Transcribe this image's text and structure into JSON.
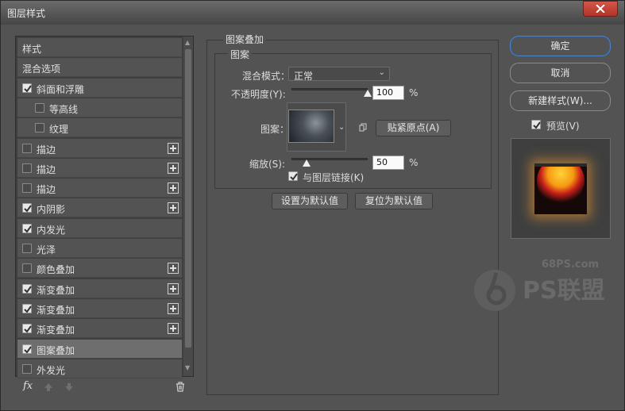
{
  "window": {
    "title": "图层样式"
  },
  "left": {
    "items": [
      {
        "label": "样式",
        "checkbox": null,
        "plus": false,
        "selected": false,
        "indent": 0
      },
      {
        "label": "混合选项",
        "checkbox": null,
        "plus": false,
        "selected": false,
        "indent": 0
      },
      {
        "label": "斜面和浮雕",
        "checkbox": true,
        "plus": false,
        "selected": false,
        "indent": 0
      },
      {
        "label": "等高线",
        "checkbox": false,
        "plus": false,
        "selected": false,
        "indent": 1
      },
      {
        "label": "纹理",
        "checkbox": false,
        "plus": false,
        "selected": false,
        "indent": 1
      },
      {
        "label": "描边",
        "checkbox": false,
        "plus": true,
        "selected": false,
        "indent": 0
      },
      {
        "label": "描边",
        "checkbox": false,
        "plus": true,
        "selected": false,
        "indent": 0
      },
      {
        "label": "描边",
        "checkbox": false,
        "plus": true,
        "selected": false,
        "indent": 0
      },
      {
        "label": "内阴影",
        "checkbox": true,
        "plus": true,
        "selected": false,
        "indent": 0
      },
      {
        "label": "内发光",
        "checkbox": true,
        "plus": false,
        "selected": false,
        "indent": 0
      },
      {
        "label": "光泽",
        "checkbox": false,
        "plus": false,
        "selected": false,
        "indent": 0
      },
      {
        "label": "颜色叠加",
        "checkbox": false,
        "plus": true,
        "selected": false,
        "indent": 0
      },
      {
        "label": "渐变叠加",
        "checkbox": true,
        "plus": true,
        "selected": false,
        "indent": 0
      },
      {
        "label": "渐变叠加",
        "checkbox": true,
        "plus": true,
        "selected": false,
        "indent": 0
      },
      {
        "label": "渐变叠加",
        "checkbox": true,
        "plus": true,
        "selected": false,
        "indent": 0
      },
      {
        "label": "图案叠加",
        "checkbox": true,
        "plus": false,
        "selected": true,
        "indent": 0
      },
      {
        "label": "外发光",
        "checkbox": false,
        "plus": false,
        "selected": false,
        "indent": 0
      }
    ],
    "fx_label": "fx"
  },
  "panel": {
    "section_title": "图案叠加",
    "group_title": "图案",
    "blend_label": "混合模式：",
    "blend_value": "正常",
    "opacity_label": "不透明度(Y):",
    "opacity_value": "100",
    "opacity_level": 1.0,
    "percent": "%",
    "pattern_label": "图案：",
    "snap_button": "贴紧原点(A)",
    "scale_label": "缩放(S):",
    "scale_value": "50",
    "scale_level": 0.2,
    "link_label": "与图层链接(K)",
    "link_checked": true,
    "set_default": "设置为默认值",
    "reset_default": "复位为默认值"
  },
  "right": {
    "ok": "确定",
    "cancel": "取消",
    "new_style": "新建样式(W)...",
    "preview_label": "预览(V)",
    "preview_checked": true
  },
  "watermark": {
    "site": "68PS.com",
    "brand": "PS联盟"
  }
}
